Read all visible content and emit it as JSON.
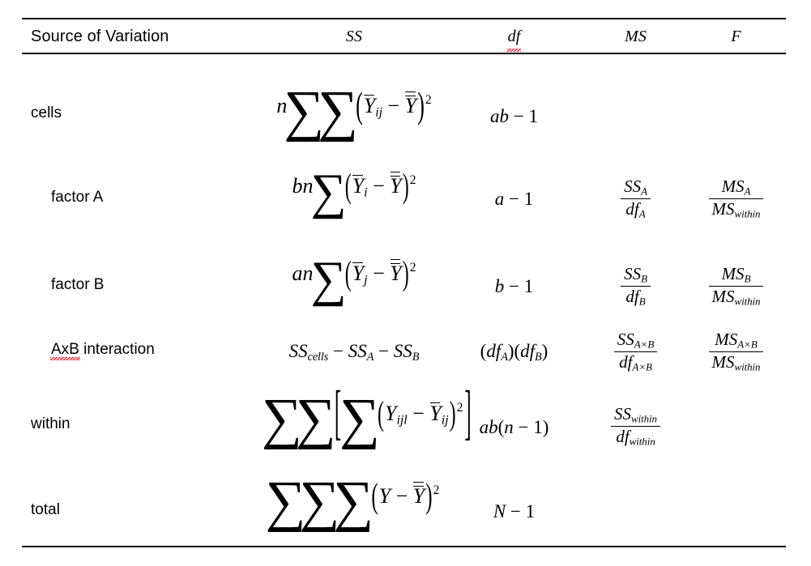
{
  "document": {
    "type": "anova-summary-table",
    "title": "Two-Way ANOVA Source Table"
  },
  "table": {
    "headers": [
      {
        "key": "source",
        "label": "Source of Variation",
        "italic": false,
        "spellcheck_flag": false
      },
      {
        "key": "ss",
        "label": "SS",
        "italic": true,
        "spellcheck_flag": false
      },
      {
        "key": "df",
        "label": "df",
        "italic": true,
        "spellcheck_flag": true
      },
      {
        "key": "ms",
        "label": "MS",
        "italic": true,
        "spellcheck_flag": false
      },
      {
        "key": "f",
        "label": "F",
        "italic": true,
        "spellcheck_flag": false
      }
    ],
    "rows": [
      {
        "source": "cells",
        "indent": false,
        "spellcheck_flag": false,
        "ss_text": "n ∑∑(Ȳᵢⱼ − Ȳ̄)²",
        "df_text": "ab − 1",
        "ms_text": "",
        "f_text": ""
      },
      {
        "source": "factor A",
        "indent": true,
        "spellcheck_flag": false,
        "ss_text": "bn ∑(Ȳᵢ − Ȳ̄)²",
        "df_text": "a − 1",
        "ms_text": "SS_A / df_A",
        "f_text": "MS_A / MS_within"
      },
      {
        "source": "factor B",
        "indent": true,
        "spellcheck_flag": false,
        "ss_text": "an ∑(Ȳⱼ − Ȳ̄)²",
        "df_text": "b − 1",
        "ms_text": "SS_B / df_B",
        "f_text": "MS_B / MS_within"
      },
      {
        "source": "AxB interaction",
        "indent": true,
        "spellcheck_flag": true,
        "ss_text": "SS_cells − SS_A − SS_B",
        "df_text": "(df_A)(df_B)",
        "ms_text": "SS_AxB / df_AxB",
        "f_text": "MS_AxB / MS_within"
      },
      {
        "source": "within",
        "indent": false,
        "spellcheck_flag": false,
        "ss_text": "∑∑[∑(Yᵢⱼₗ − Ȳᵢⱼ)²]",
        "df_text": "ab(n − 1)",
        "ms_text": "SS_within / df_within",
        "f_text": ""
      },
      {
        "source": "total",
        "indent": false,
        "spellcheck_flag": false,
        "ss_text": "∑∑∑(Y − Ȳ̄)²",
        "df_text": "N − 1",
        "ms_text": "",
        "f_text": ""
      }
    ]
  },
  "math": {
    "coef_n": "n",
    "coef_bn": "bn",
    "coef_an": "an",
    "minus": "−",
    "times": "×",
    "sigma": "∑",
    "Y": "Y",
    "SS": "SS",
    "MS": "MS",
    "df": "df",
    "one": "1",
    "sub_i": "i",
    "sub_j": "j",
    "sub_ij": "ij",
    "sub_ijl": "ijl",
    "sub_A": "A",
    "sub_B": "B",
    "sub_AxB": "A×B",
    "sub_cells": "cells",
    "sub_within": "within",
    "var_a": "a",
    "var_b": "b",
    "var_ab": "ab",
    "var_n": "n",
    "var_N": "N",
    "exp_2": "2",
    "lparen": "(",
    "rparen": ")",
    "lbracket": "[",
    "rbracket": "]"
  },
  "colors": {
    "text": "#000000",
    "rule": "#000000",
    "spellcheck_underline": "#e8222a",
    "background": "#ffffff"
  }
}
